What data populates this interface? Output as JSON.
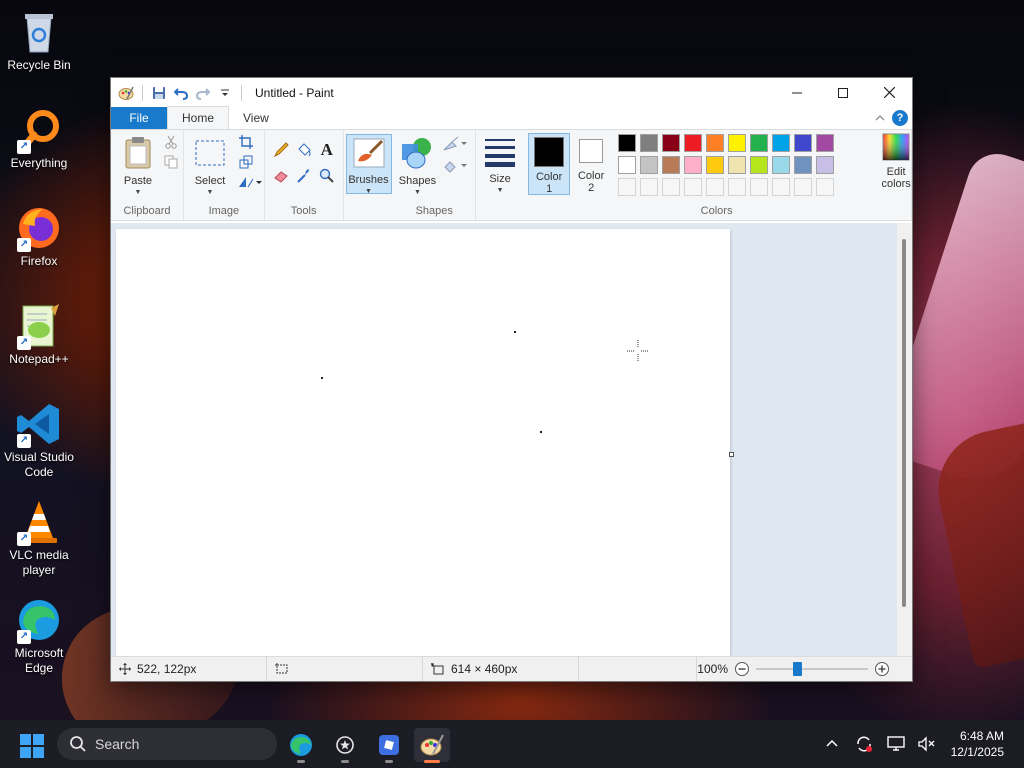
{
  "desktop": {
    "icons": [
      {
        "label": "Recycle Bin",
        "icon": "recycle-bin-icon"
      },
      {
        "label": "Everything",
        "icon": "everything-icon"
      },
      {
        "label": "Firefox",
        "icon": "firefox-icon"
      },
      {
        "label": "Notepad++",
        "icon": "notepad-plus-plus-icon"
      },
      {
        "label": "Visual Studio Code",
        "icon": "vscode-icon"
      },
      {
        "label": "VLC media player",
        "icon": "vlc-icon"
      },
      {
        "label": "Microsoft Edge",
        "icon": "edge-icon"
      }
    ]
  },
  "window": {
    "title": "Untitled - Paint",
    "tabs": {
      "file": "File",
      "home": "Home",
      "view": "View"
    }
  },
  "ribbon": {
    "clipboard": {
      "label": "Clipboard",
      "paste": "Paste"
    },
    "image": {
      "label": "Image",
      "select": "Select"
    },
    "tools": {
      "label": "Tools"
    },
    "brushes": {
      "label": "Brushes"
    },
    "shapes": {
      "label": "Shapes",
      "shapes_btn": "Shapes"
    },
    "size": {
      "label": "Size"
    },
    "colors": {
      "label": "Colors",
      "color1": "Color",
      "color1_num": "1",
      "color2": "Color",
      "color2_num": "2",
      "edit": "Edit",
      "edit2": "colors",
      "color1_value": "#000000",
      "color2_value": "#ffffff",
      "palette_row1": [
        "#000000",
        "#7f7f7f",
        "#880015",
        "#ed1c24",
        "#ff7f27",
        "#fff200",
        "#22b14c",
        "#00a2e8",
        "#3f48cc",
        "#a349a4"
      ],
      "palette_row2": [
        "#ffffff",
        "#c3c3c3",
        "#b97a57",
        "#ffaec9",
        "#ffc90e",
        "#efe4b0",
        "#b5e61d",
        "#99d9ea",
        "#7092be",
        "#c8bfe7"
      ]
    }
  },
  "status": {
    "cursor": "522, 122px",
    "size": "614 × 460px",
    "zoom": "100%"
  },
  "taskbar": {
    "search": "Search",
    "time": "6:48 AM",
    "date": "12/1/2025"
  }
}
